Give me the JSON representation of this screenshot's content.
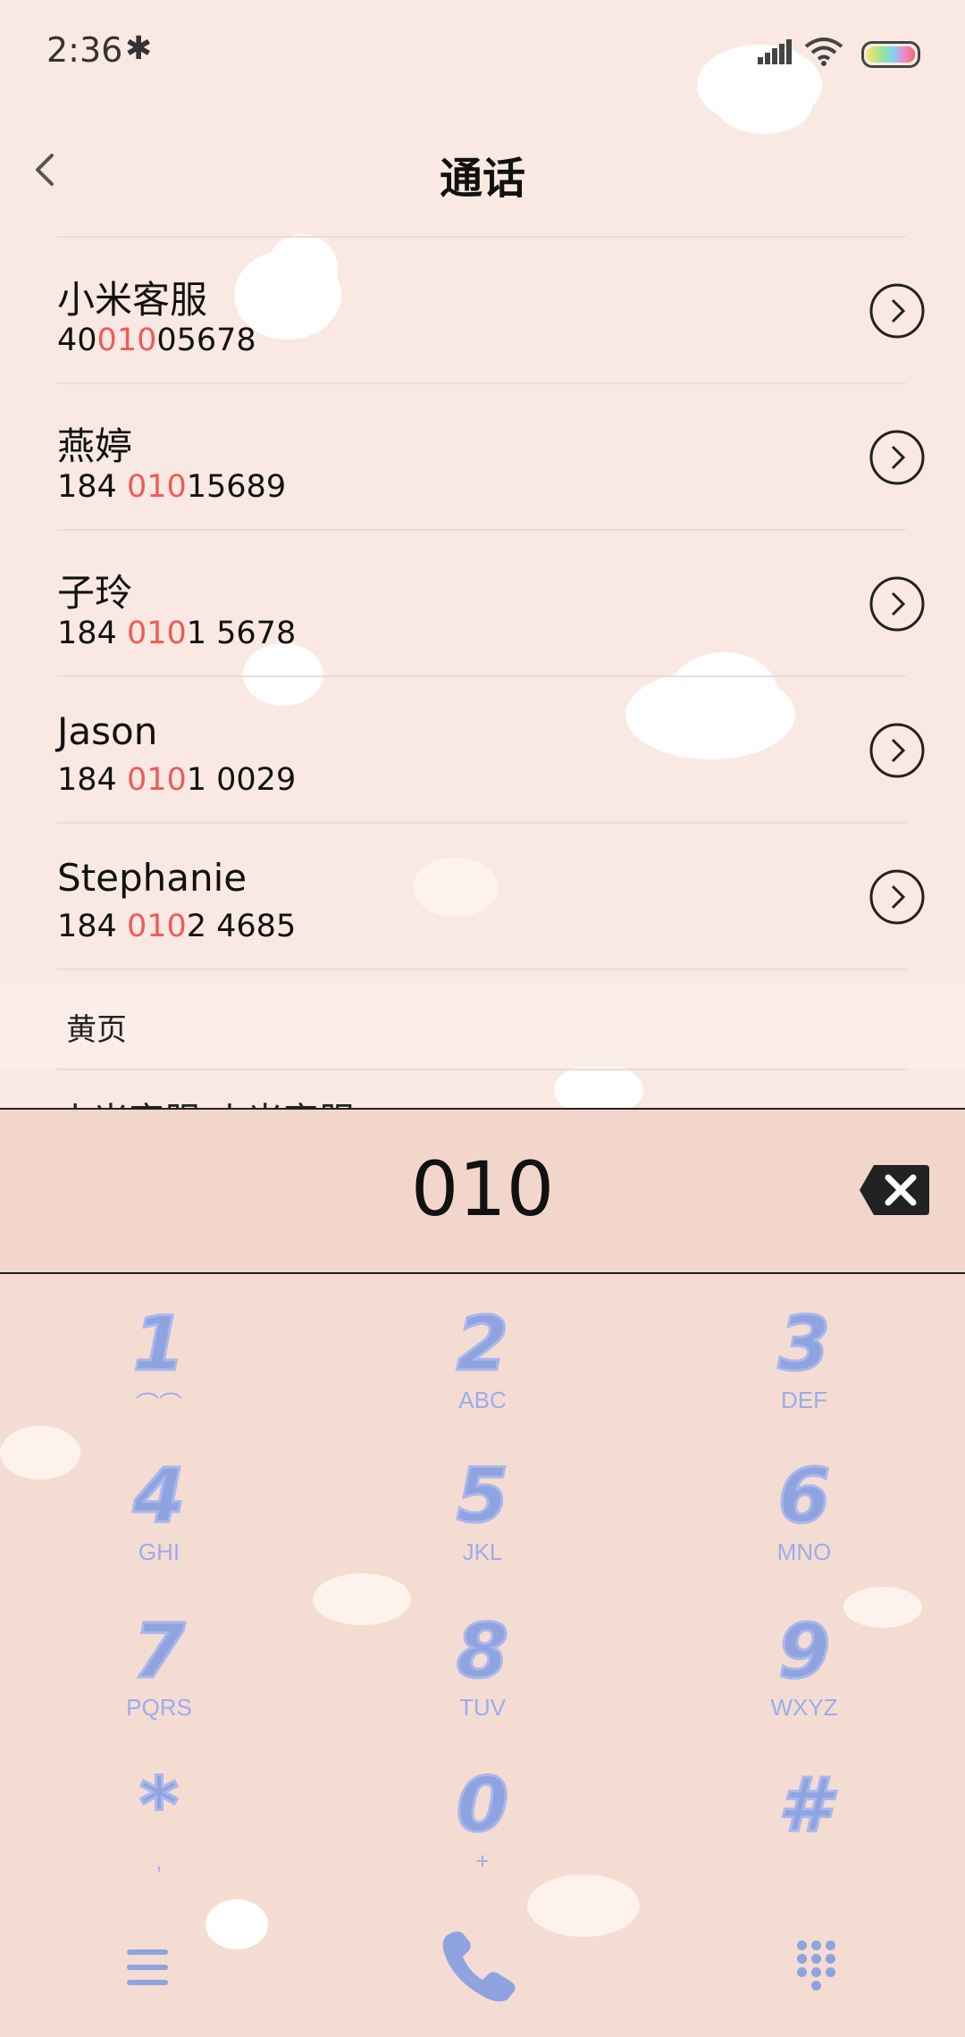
{
  "status_bar": {
    "time": "2:36",
    "bluetooth_icon": "bluetooth-icon",
    "signal_icon": "signal-icon",
    "wifi_icon": "wifi-icon",
    "battery_icon": "battery-icon"
  },
  "header": {
    "title": "通话",
    "back_icon": "chevron-left-icon"
  },
  "contacts": [
    {
      "name": "小米客服",
      "num_pre": "40",
      "num_hl": "010",
      "num_post": "05678"
    },
    {
      "name": "燕婷",
      "num_pre": "184 ",
      "num_hl": "010",
      "num_post": "15689"
    },
    {
      "name": "子玲",
      "num_pre": "184 ",
      "num_hl": "010",
      "num_post": "1 5678"
    },
    {
      "name": "Jason",
      "num_pre": "184 ",
      "num_hl": "010",
      "num_post": "1 0029"
    },
    {
      "name": "Stephanie",
      "num_pre": "184 ",
      "num_hl": "010",
      "num_post": "2 4685"
    }
  ],
  "yellow_pages": {
    "label": "黄页",
    "partial_item": "小米客服 小米客服"
  },
  "dial_input": {
    "value": "010",
    "delete_icon": "backspace-icon"
  },
  "keypad": [
    {
      "digit": "1",
      "letters": "⌂"
    },
    {
      "digit": "2",
      "letters": "ABC"
    },
    {
      "digit": "3",
      "letters": "DEF"
    },
    {
      "digit": "4",
      "letters": "GHI"
    },
    {
      "digit": "5",
      "letters": "JKL"
    },
    {
      "digit": "6",
      "letters": "MNO"
    },
    {
      "digit": "7",
      "letters": "PQRS"
    },
    {
      "digit": "8",
      "letters": "TUV"
    },
    {
      "digit": "9",
      "letters": "WXYZ"
    },
    {
      "digit": "*",
      "letters": ","
    },
    {
      "digit": "0",
      "letters": "+"
    },
    {
      "digit": "#",
      "letters": ""
    }
  ],
  "bottom_bar": {
    "menu_icon": "menu-icon",
    "call_icon": "phone-icon",
    "keypad_icon": "dialpad-icon"
  },
  "colors": {
    "background": "#fae9e2",
    "highlight": "#f05a5a",
    "keypad_accent": "#8fa3e0",
    "input_bar": "#f2d6cc"
  }
}
